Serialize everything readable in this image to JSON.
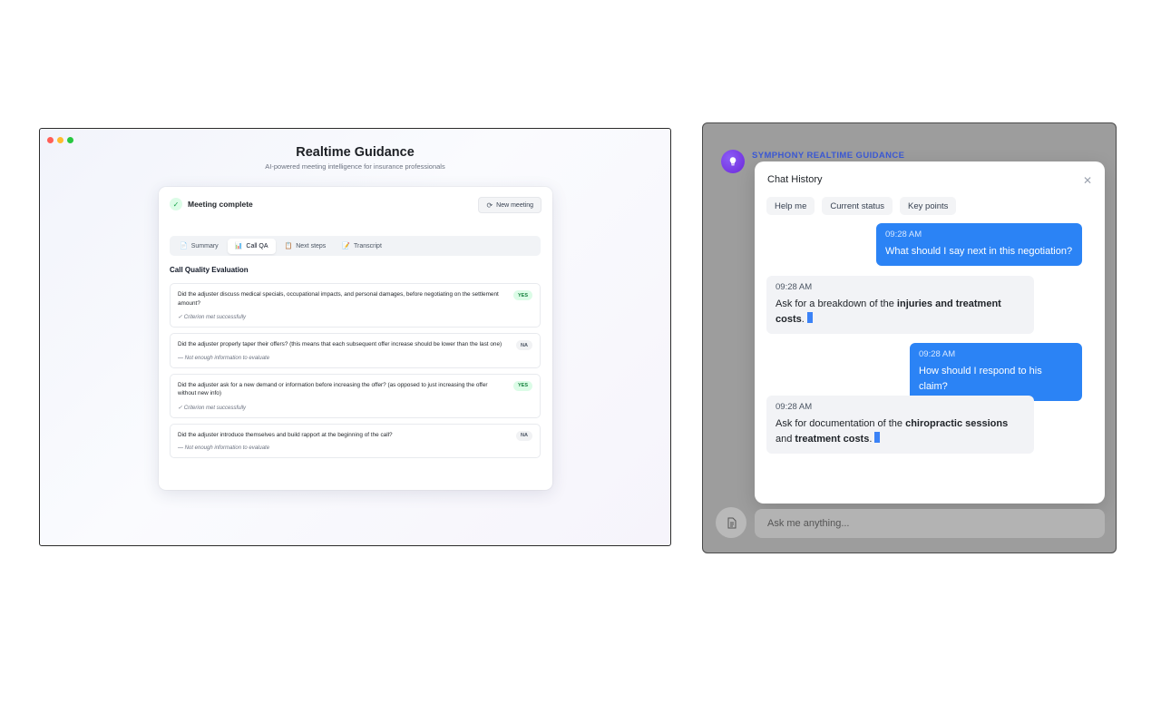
{
  "left_app": {
    "title": "Realtime Guidance",
    "subtitle": "AI-powered meeting intelligence for insurance professionals",
    "status": "Meeting complete",
    "new_meeting_label": "New meeting",
    "tabs": [
      {
        "label": "Summary",
        "icon": "📄"
      },
      {
        "label": "Call QA",
        "icon": "📊"
      },
      {
        "label": "Next steps",
        "icon": "📋"
      },
      {
        "label": "Transcript",
        "icon": "📝"
      }
    ],
    "active_tab": "Call QA",
    "section_title": "Call Quality Evaluation",
    "qa_items": [
      {
        "question": "Did the adjuster discuss medical specials, occupational impacts, and personal damages, before negotiating on the settlement amount?",
        "badge": "YES",
        "note": "✓ Criterion met successfully"
      },
      {
        "question": "Did the adjuster properly taper their offers? (this means that each subsequent offer increase should be lower than the last one)",
        "badge": "NA",
        "note": "— Not enough information to evaluate"
      },
      {
        "question": "Did the adjuster ask for a new demand or information before increasing the offer? (as opposed to just increasing the offer without new info)",
        "badge": "YES",
        "note": "✓ Criterion met successfully"
      },
      {
        "question": "Did the adjuster introduce themselves and build rapport at the beginning of the call?",
        "badge": "NA",
        "note": "— Not enough information to evaluate"
      }
    ],
    "colors": {
      "yes": "#15803d",
      "na": "#4b5563"
    }
  },
  "right_app": {
    "brand": "SYMPHONY REALTIME GUIDANCE",
    "chat_title": "Chat History",
    "chips": [
      "Help me",
      "Current status",
      "Key points"
    ],
    "messages": [
      {
        "role": "user",
        "time": "09:28 AM",
        "text": "What should I say next in this negotiation?"
      },
      {
        "role": "bot",
        "time": "09:28 AM",
        "pre": "Ask for a breakdown of the ",
        "bold1": "injuries and treatment costs",
        "mid": "",
        "bold2": "",
        "post": "."
      },
      {
        "role": "user",
        "time": "09:28 AM",
        "text": "How should I respond to his claim?"
      },
      {
        "role": "bot",
        "time": "09:28 AM",
        "pre": "Ask for documentation of the ",
        "bold1": "chiropractic sessions",
        "mid": " and ",
        "bold2": "treatment costs",
        "post": "."
      }
    ],
    "input_placeholder": "Ask me anything...",
    "colors": {
      "user_bubble": "#2b83f5",
      "brand": "#3b59d6"
    }
  }
}
